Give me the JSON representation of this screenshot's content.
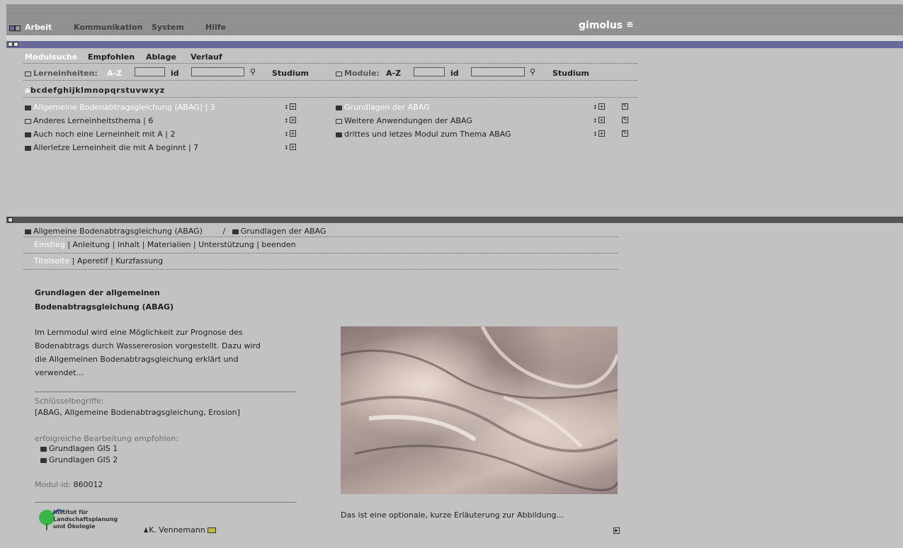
{
  "menu": {
    "items": [
      "Arbeit",
      "Kommunikation",
      "System",
      "Hilfe"
    ],
    "logo": "gimolus"
  },
  "search_tabs": [
    "Modulsuche",
    "Empfohlen",
    "Ablage",
    "Verlauf"
  ],
  "lerneinheiten": {
    "label": "Lerneinheiten:",
    "az": "A-Z",
    "id": "id",
    "studium": "Studium"
  },
  "module": {
    "label": "Module:",
    "az": "A-Z",
    "id": "id",
    "studium": "Studium"
  },
  "alphabet": [
    "a",
    "b",
    "c",
    "d",
    "e",
    "f",
    "g",
    "h",
    "i",
    "j",
    "k",
    "l",
    "m",
    "n",
    "o",
    "p",
    "q",
    "r",
    "s",
    "t",
    "u",
    "v",
    "w",
    "x",
    "y",
    "z"
  ],
  "lerneinheiten_list": [
    {
      "title": "Allgemeine Bodenabtragsgleichung (ABAG) | 3",
      "selected": true
    },
    {
      "title": "Anderes Lerneinheitsthema | 6",
      "selected": false
    },
    {
      "title": "Auch noch eine Lerneinheit mit A | 2",
      "selected": false
    },
    {
      "title": "Allerletze Lerneinheit die mit A beginnt | 7",
      "selected": false
    }
  ],
  "module_list": [
    {
      "title": "Grundlagen der ABAG",
      "selected": true
    },
    {
      "title": "Weitere Anwendungen der ABAG",
      "selected": false
    },
    {
      "title": "drittes und letzes Modul zum Thema ABAG",
      "selected": false
    }
  ],
  "breadcrumb": {
    "unit": "Allgemeine Bodenabtragsgleichung (ABAG)",
    "sep": "/",
    "module": "Grundlagen der ABAG"
  },
  "nav1": [
    "Einstieg",
    "Anleitung",
    "Inhalt",
    "Materialien",
    "Unterstützung",
    "beenden"
  ],
  "nav2": [
    "Titelseite",
    "Aperetif",
    "Kurzfassung"
  ],
  "content": {
    "title_line1": "Grundlagen der allgemeinen",
    "title_line2": "Bodenabtragsgleichung (ABAG)",
    "intro_lines": [
      "Im Lernmodul wird eine Möglichkeit zur Prognose des",
      "Bodenabtrags durch Wassererosion vorgestellt. Dazu wird",
      "die Allgemeinen Bodenabtragsgleichung erklärt und",
      "verwendet..."
    ],
    "keywords_label": "Schlüsselbegriffe:",
    "keywords": "[ABAG, Allgemeine Bodenabtragsgleichung, Erosion]",
    "prereq_label": "erfolgreiche Bearbeitung empfohlen:",
    "prereqs": [
      "Grundlagen GIS 1",
      "Grundlagen GIS 2"
    ],
    "modul_id_label": "Modul-id:",
    "modul_id": "860012",
    "institute_lines": [
      "Institut für",
      "Landschaftsplanung",
      "und Ökologie"
    ],
    "author": "K. Vennemann",
    "caption": "Das ist eine optionale, kurze Erläuterung zur Abbildung..."
  },
  "colors": {
    "background": "#c2c2c2",
    "accent_bar": "#6a6a9a",
    "dark_bar": "#555555",
    "highlight_text": "#ffffff"
  }
}
